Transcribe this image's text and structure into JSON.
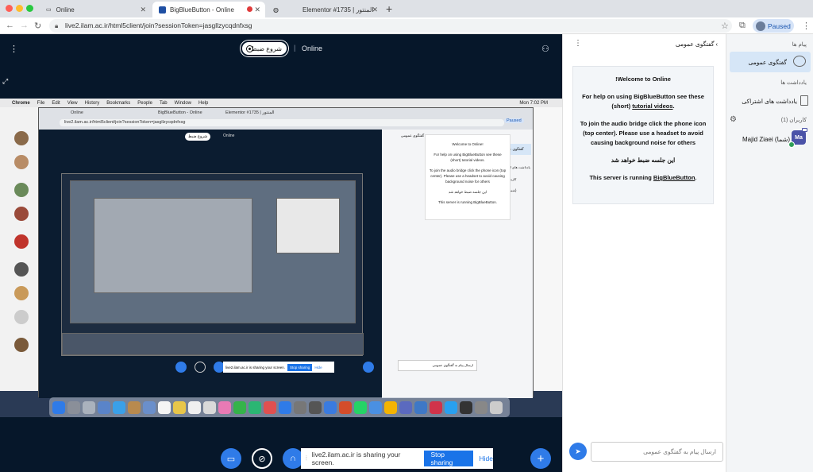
{
  "browser": {
    "tabs": [
      {
        "label": "Online"
      },
      {
        "label": "BigBlueButton - Online"
      },
      {
        "label": "Elementor #1735 | المنتور"
      }
    ],
    "url": "live2.ilam.ac.ir/html5client/join?sessionToken=jasgllzycqdnfxsg",
    "profile_status": "Paused"
  },
  "meeting": {
    "title": "Online",
    "record_label": "شروع ضبط"
  },
  "screenshare": {
    "menu": [
      "Chrome",
      "File",
      "Edit",
      "View",
      "History",
      "Bookmarks",
      "People",
      "Tab",
      "Window",
      "Help"
    ],
    "clock": "Mon 7:02 PM",
    "inner_tabs": [
      "Online",
      "BigBlueButton - Online",
      "Elementor #1735 | المنتور"
    ],
    "inner_url": "live2.ilam.ac.ir/html5client/join?sessionToken=jasgllzycqdnfxsg",
    "inner_paused": "Paused",
    "inner_title": "Online",
    "inner_record": "شروع ضبط",
    "inner_welcome": [
      "Welcome to Online!",
      "For help on using BigBlueButton see these (short) tutorial videos.",
      "To join the audio bridge click the phone icon (top center). Please use a headset to avoid causing background noise for others",
      "این جلسه ضبط خواهد شد",
      "This server is running BigBlueButton."
    ],
    "inner_public_chat": "گفتگوی عمومی",
    "inner_shared_notes": "یادداشت های اشتراکی",
    "inner_users": "کاربران (1)",
    "inner_user": "Majid Ziaei (شما)",
    "inner_sharing": "live2.ilam.ac.ir is sharing your screen.",
    "inner_stop": "Stop sharing",
    "inner_hide": "Hide",
    "inner_chat_placeholder": "ارسال پیام به گفتگوی عمومی"
  },
  "sharebar": {
    "text": "live2.ilam.ac.ir is sharing your screen.",
    "stop_label": "Stop sharing",
    "hide_label": "Hide"
  },
  "chat": {
    "header": "گفتگوی عمومی",
    "welcome_title": "Welcome to Online!",
    "help_line_prefix": "For help on using BigBlueButton see these (short) ",
    "help_link": "tutorial videos",
    "help_suffix": ".",
    "audio_text": "To join the audio bridge click the phone icon (top center). Please use a headset to avoid causing background noise for others",
    "record_notice": "این جلسه ضبط خواهد شد",
    "server_prefix": "This server is running ",
    "server_link": "BigBlueButton",
    "server_suffix": ".",
    "input_placeholder": "ارسال پیام به گفتگوی عمومی"
  },
  "userlist": {
    "messages_title": "پیام ها",
    "public_chat": "گفتگوی عمومی",
    "notes_title": "یادداشت ها",
    "shared_notes": "یادداشت های اشتراکی",
    "users_title": "کاربران (1)",
    "user_name": "Majid Ziaei (شما)",
    "user_initials": "Ma"
  }
}
